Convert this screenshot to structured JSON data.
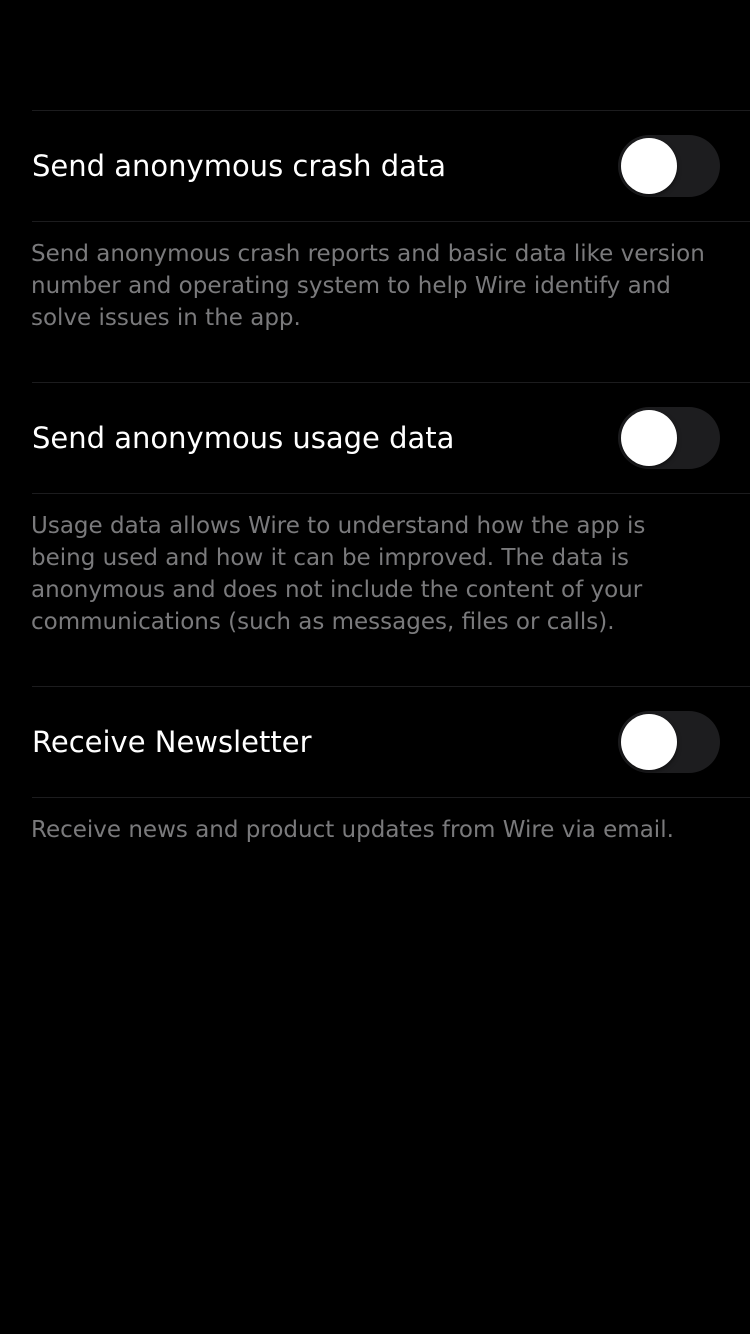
{
  "settings": [
    {
      "label": "Send anonymous crash data",
      "enabled": false,
      "footer": "Send anonymous crash reports and basic data like version number and operating system to help Wire identify and solve issues in the app."
    },
    {
      "label": "Send anonymous usage data",
      "enabled": false,
      "footer": "Usage data allows Wire to understand how the app is being used and how it can be improved. The data is anonymous and does not include the content of your communications (such as messages, files or calls)."
    },
    {
      "label": "Receive Newsletter",
      "enabled": false,
      "footer": "Receive news and product updates from Wire via email."
    }
  ],
  "colors": {
    "background": "#000000",
    "label": "#ffffff",
    "footer_text": "#7a7a7c",
    "separator": "#1c1c1e",
    "toggle_off_track": "#1d1d1f",
    "toggle_knob": "#ffffff"
  }
}
